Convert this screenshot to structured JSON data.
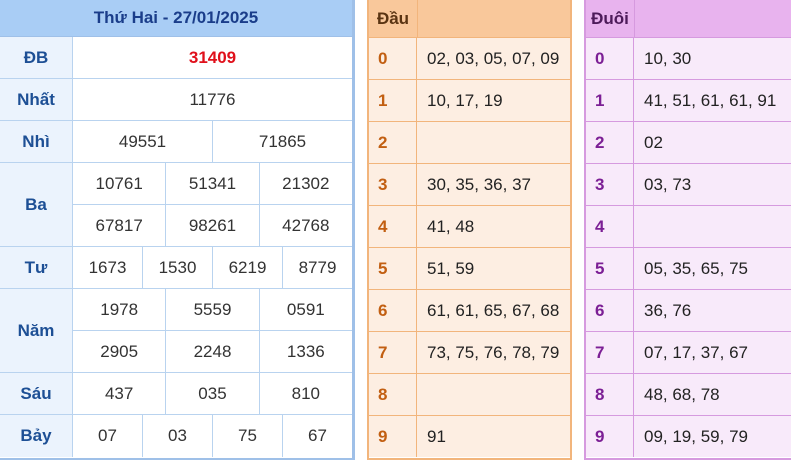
{
  "results": {
    "title": "Thứ Hai - 27/01/2025",
    "prizes": [
      {
        "label": "ĐB",
        "lines": [
          [
            "31409"
          ]
        ],
        "special": true
      },
      {
        "label": "Nhất",
        "lines": [
          [
            "11776"
          ]
        ]
      },
      {
        "label": "Nhì",
        "lines": [
          [
            "49551",
            "71865"
          ]
        ]
      },
      {
        "label": "Ba",
        "lines": [
          [
            "10761",
            "51341",
            "21302"
          ],
          [
            "67817",
            "98261",
            "42768"
          ]
        ]
      },
      {
        "label": "Tư",
        "lines": [
          [
            "1673",
            "1530",
            "6219",
            "8779"
          ]
        ]
      },
      {
        "label": "Năm",
        "lines": [
          [
            "1978",
            "5559",
            "0591"
          ],
          [
            "2905",
            "2248",
            "1336"
          ]
        ]
      },
      {
        "label": "Sáu",
        "lines": [
          [
            "437",
            "035",
            "810"
          ]
        ]
      },
      {
        "label": "Bảy",
        "lines": [
          [
            "07",
            "03",
            "75",
            "67"
          ]
        ]
      }
    ]
  },
  "dau": {
    "header": "Đầu",
    "rows": [
      {
        "key": "0",
        "value": "02, 03, 05, 07, 09"
      },
      {
        "key": "1",
        "value": "10, 17, 19"
      },
      {
        "key": "2",
        "value": ""
      },
      {
        "key": "3",
        "value": "30, 35, 36, 37"
      },
      {
        "key": "4",
        "value": "41, 48"
      },
      {
        "key": "5",
        "value": "51, 59"
      },
      {
        "key": "6",
        "value": "61, 61, 65, 67, 68"
      },
      {
        "key": "7",
        "value": "73, 75, 76, 78, 79"
      },
      {
        "key": "8",
        "value": ""
      },
      {
        "key": "9",
        "value": "91"
      }
    ]
  },
  "duoi": {
    "header": "Đuôi",
    "rows": [
      {
        "key": "0",
        "value": "10, 30"
      },
      {
        "key": "1",
        "value": "41, 51, 61, 61, 91"
      },
      {
        "key": "2",
        "value": "02"
      },
      {
        "key": "3",
        "value": "03, 73"
      },
      {
        "key": "4",
        "value": ""
      },
      {
        "key": "5",
        "value": "05, 35, 65, 75"
      },
      {
        "key": "6",
        "value": "36, 76"
      },
      {
        "key": "7",
        "value": "07, 17, 37, 67"
      },
      {
        "key": "8",
        "value": "48, 68, 78"
      },
      {
        "key": "9",
        "value": "09, 19, 59, 79"
      }
    ]
  }
}
